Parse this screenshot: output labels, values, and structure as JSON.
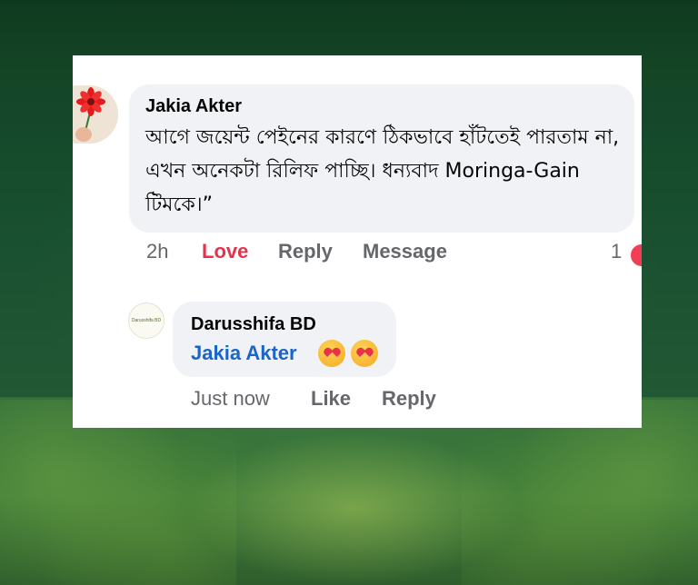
{
  "comment": {
    "author": "Jakia Akter",
    "text": "আগে জয়েন্ট পেইনের কারণে ঠিকভাবে হাঁটতেই পারতাম না, এখন অনেকটা রিলিফ পাচ্ছি। ধন্যবাদ Moringa-Gain টিমকে।”",
    "time": "2h",
    "reaction_label": "Love",
    "reply_label": "Reply",
    "message_label": "Message",
    "reaction_count": "1",
    "reaction_icon": "love-reaction-icon"
  },
  "reply": {
    "author": "Darusshifa BD",
    "avatar_text": "Darusshifa BD",
    "mention": "Jakia Akter",
    "emoji": "smiling-face-with-hearts-icon",
    "time": "Just now",
    "like_label": "Like",
    "reply_label": "Reply"
  },
  "colors": {
    "love": "#e4324c",
    "mention": "#1b64c9",
    "bubble": "#f0f2f5",
    "meta_text": "#65676b"
  }
}
